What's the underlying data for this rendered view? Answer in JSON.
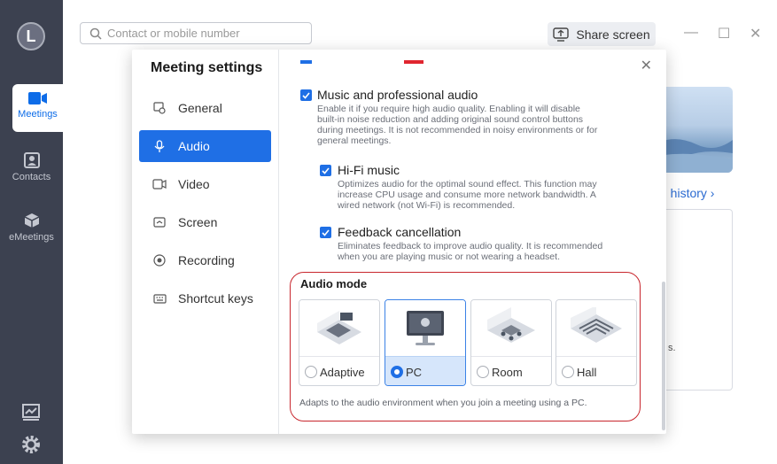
{
  "rail": {
    "logo_letter": "L",
    "items": [
      {
        "label": "Meetings",
        "icon": "camera-icon",
        "active": true
      },
      {
        "label": "Contacts",
        "icon": "contacts-icon",
        "active": false
      },
      {
        "label": "eMeetings",
        "icon": "cube-icon",
        "active": false
      }
    ],
    "bottom_icons": [
      "whiteboard-icon",
      "settings-gear-icon"
    ]
  },
  "topbar": {
    "search_placeholder": "Contact or mobile number",
    "share_label": "Share screen",
    "window_controls": {
      "minimize": "—",
      "maximize": "☐",
      "close": "✕"
    }
  },
  "background": {
    "history_link": "g history ›",
    "truncated_text": "s."
  },
  "dialog": {
    "title": "Meeting settings",
    "close": "✕",
    "nav": [
      {
        "label": "General",
        "icon": "general-icon",
        "active": false
      },
      {
        "label": "Audio",
        "icon": "mic-icon",
        "active": true
      },
      {
        "label": "Video",
        "icon": "video-icon",
        "active": false
      },
      {
        "label": "Screen",
        "icon": "screen-icon",
        "active": false
      },
      {
        "label": "Recording",
        "icon": "record-icon",
        "active": false
      },
      {
        "label": "Shortcut keys",
        "icon": "keyboard-icon",
        "active": false
      }
    ],
    "options": {
      "music": {
        "label": "Music and professional audio",
        "checked": true,
        "description": [
          "Enable it if you require high audio quality. Enabling it will disable",
          "built-in noise reduction and adding original sound control buttons",
          "during meetings. It is not recommended in noisy environments or for",
          "general meetings."
        ]
      },
      "hifi": {
        "label": "Hi-Fi music",
        "checked": true,
        "description": [
          "Optimizes audio for the optimal sound effect. This function may",
          "increase CPU usage and consume more network bandwidth. A",
          "wired network (not Wi-Fi) is recommended."
        ]
      },
      "feedback": {
        "label": "Feedback cancellation",
        "checked": true,
        "description": [
          "Eliminates feedback to improve audio quality. It is recommended",
          "when you are playing music or not wearing a headset."
        ]
      }
    },
    "audio_mode": {
      "title": "Audio mode",
      "selected": "PC",
      "modes": [
        {
          "label": "Adaptive",
          "icon": "adaptive-room-icon"
        },
        {
          "label": "PC",
          "icon": "pc-monitor-icon"
        },
        {
          "label": "Room",
          "icon": "meeting-room-icon"
        },
        {
          "label": "Hall",
          "icon": "hall-icon"
        }
      ],
      "note": "Adapts to the audio environment when you join a meeting using a PC."
    }
  },
  "colors": {
    "accent": "#1f6fe5",
    "rail": "#3c4150",
    "highlight_outline": "#c8262d"
  }
}
